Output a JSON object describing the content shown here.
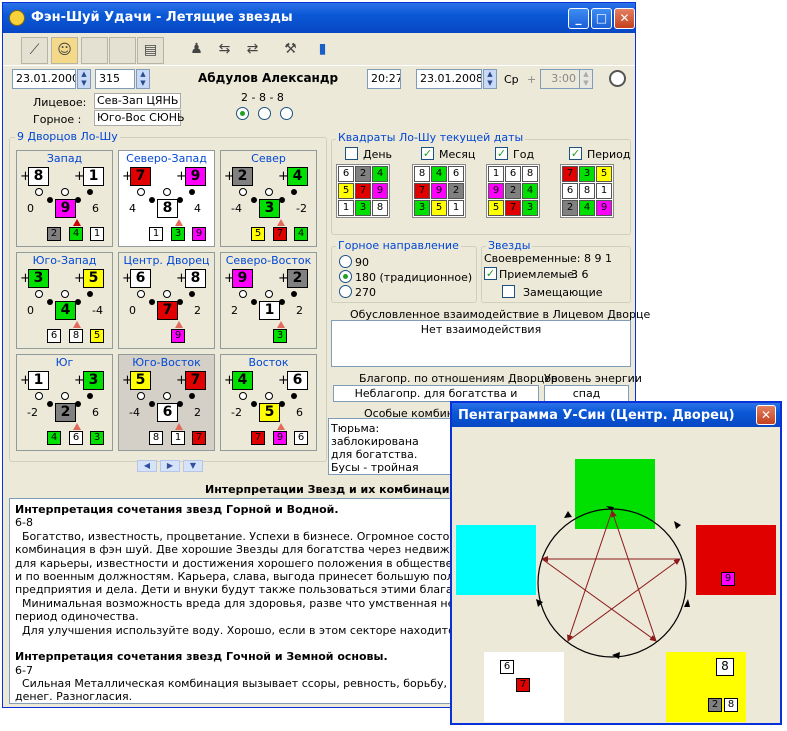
{
  "window": {
    "title": "Фэн-Шуй Удачи - Летящие звезды",
    "min": "_",
    "max": "□",
    "close": "✕"
  },
  "toolbar": {
    "icons": [
      "chart-icon",
      "person-icon",
      "blank-icon",
      "blank-icon",
      "document-icon",
      "people-icon",
      "cursor-icon",
      "arrows-icon",
      "tool-icon",
      "exit-icon"
    ]
  },
  "header": {
    "date1": "23.01.2000",
    "num": "315",
    "name": "Абдулов Александр",
    "time": "20:27",
    "date2": "23.01.2008",
    "weekday": "Ср",
    "plus": "+",
    "time2": "3:00",
    "lic_label": "Лицевое:",
    "lic_val": "Сев-Зап  ЦЯНЬ",
    "gor_label": "Горное :",
    "gor_val": "Юго-Вос  СЮНЬ",
    "combo": "2  -  8  -  8"
  },
  "luoshu": {
    "title": "9 Дворцов Ло-Шу"
  },
  "palaces": [
    {
      "name": "Запад",
      "a": "8",
      "b": "1",
      "c": "9",
      "l": "0",
      "r": "6",
      "s": [
        "2",
        "4",
        "1"
      ]
    },
    {
      "name": "Северо-Запад",
      "a": "7",
      "b": "9",
      "c": "8",
      "l": "4",
      "r": "4",
      "s": [
        "1",
        "3",
        "9"
      ]
    },
    {
      "name": "Север",
      "a": "2",
      "b": "4",
      "c": "3",
      "l": "-4",
      "r": "-2",
      "s": [
        "5",
        "7",
        "4"
      ]
    },
    {
      "name": "Юго-Запад",
      "a": "3",
      "b": "5",
      "c": "4",
      "l": "0",
      "r": "-4",
      "s": [
        "6",
        "8",
        "5"
      ]
    },
    {
      "name": "Центр. Дворец",
      "a": "6",
      "b": "8",
      "c": "7",
      "l": "0",
      "r": "2",
      "s": [
        "9"
      ]
    },
    {
      "name": "Северо-Восток",
      "a": "9",
      "b": "2",
      "c": "1",
      "l": "2",
      "r": "2",
      "s": [
        "3"
      ]
    },
    {
      "name": "Юг",
      "a": "1",
      "b": "3",
      "c": "2",
      "l": "-2",
      "r": "6",
      "s": [
        "4",
        "6",
        "3"
      ]
    },
    {
      "name": "Юго-Восток",
      "a": "5",
      "b": "7",
      "c": "6",
      "l": "-4",
      "r": "2",
      "s": [
        "8",
        "1",
        "7"
      ]
    },
    {
      "name": "Восток",
      "a": "4",
      "b": "6",
      "c": "5",
      "l": "-2",
      "r": "6",
      "s": [
        "7",
        "9",
        "6"
      ]
    }
  ],
  "squares": {
    "title": "Квадраты Ло-Шу текущей даты",
    "labels": [
      "День",
      "Месяц",
      "Год",
      "Период"
    ],
    "grids": [
      [
        "6",
        "2",
        "4",
        "5",
        "7",
        "9",
        "1",
        "3",
        "8"
      ],
      [
        "8",
        "4",
        "6",
        "7",
        "9",
        "2",
        "3",
        "5",
        "1"
      ],
      [
        "1",
        "6",
        "8",
        "9",
        "2",
        "4",
        "5",
        "7",
        "3"
      ],
      [
        "7",
        "3",
        "5",
        "6",
        "8",
        "1",
        "2",
        "4",
        "9"
      ]
    ]
  },
  "mountain": {
    "title": "Горное направление",
    "opts": [
      "90",
      "180 (традиционное)",
      "270"
    ]
  },
  "stars": {
    "title": "Звезды",
    "timely": "Своевременные: 8 9 1",
    "accept_label": "Приемлемые:",
    "accept_val": "3 6",
    "replace": "Замещающие"
  },
  "interaction": {
    "title": "Обусловленное взаимодействие в Лицевом Дворце",
    "value": "Нет взаимодействия"
  },
  "blago": {
    "label": "Благопр. по отношениям Дворцов",
    "value": "Неблагопр. для богатства и здоровья",
    "energy_label": "Уровень энергии",
    "energy_value": "спад"
  },
  "special": {
    "title": "Особые комбинации",
    "text": [
      "Тюрьма: заблокирована",
      "для богатства.",
      "Бусы - тройная удача в"
    ]
  },
  "interp": {
    "title": "Интерпретации Звезд и их комбинаций",
    "lines": [
      {
        "b": true,
        "t": "Интерпретация сочетания звезд Горной и Водной."
      },
      {
        "t": "6-8"
      },
      {
        "t": "  Богатство, известность, процветание. Успехи в бизнесе. Огромное состояние. Возм"
      },
      {
        "t": "комбинация в фэн шуй. Две хорошие Звезды для богатства через недвижимое имущ"
      },
      {
        "t": "для карьеры, известности и достижения хорошего положения в обществе. Будет пр"
      },
      {
        "t": "и по военным должностям. Карьера, слава, выгода принесет большую пользу. Будут"
      },
      {
        "t": "предприятия и дела. Дети и внуки будут также пользоваться этими благами."
      },
      {
        "t": "  Минимальная возможность вреда для здоровья, разве что умственная нестабильно"
      },
      {
        "t": "период одиночества."
      },
      {
        "t": "  Для улучшения используйте воду. Хорошо, если в этом секторе находится входная"
      },
      {
        "t": ""
      },
      {
        "b": true,
        "t": "Интерпретация сочетания звезд Гочной и Земной основы."
      },
      {
        "t": "6-7"
      },
      {
        "t": "  Сильная Металлическая комбинация вызывает ссоры, ревность, борьбу, обман, гра"
      },
      {
        "t": "денег. Разногласия."
      }
    ]
  },
  "pentagram": {
    "title": "Пентаграмма У-Син (Центр. Дворец)",
    "close": "✕",
    "fire": "9",
    "earth_a": "6",
    "earth_b": "7",
    "yellow_a": "8",
    "yellow_b": "2",
    "yellow_c": "8"
  },
  "colors": {
    "green": "#00E000",
    "red": "#E00000",
    "cyan": "#00FFFF",
    "yellow": "#FFFF00",
    "magenta": "#FF00FF",
    "gray": "#808080",
    "white": "#FFFFFF"
  }
}
